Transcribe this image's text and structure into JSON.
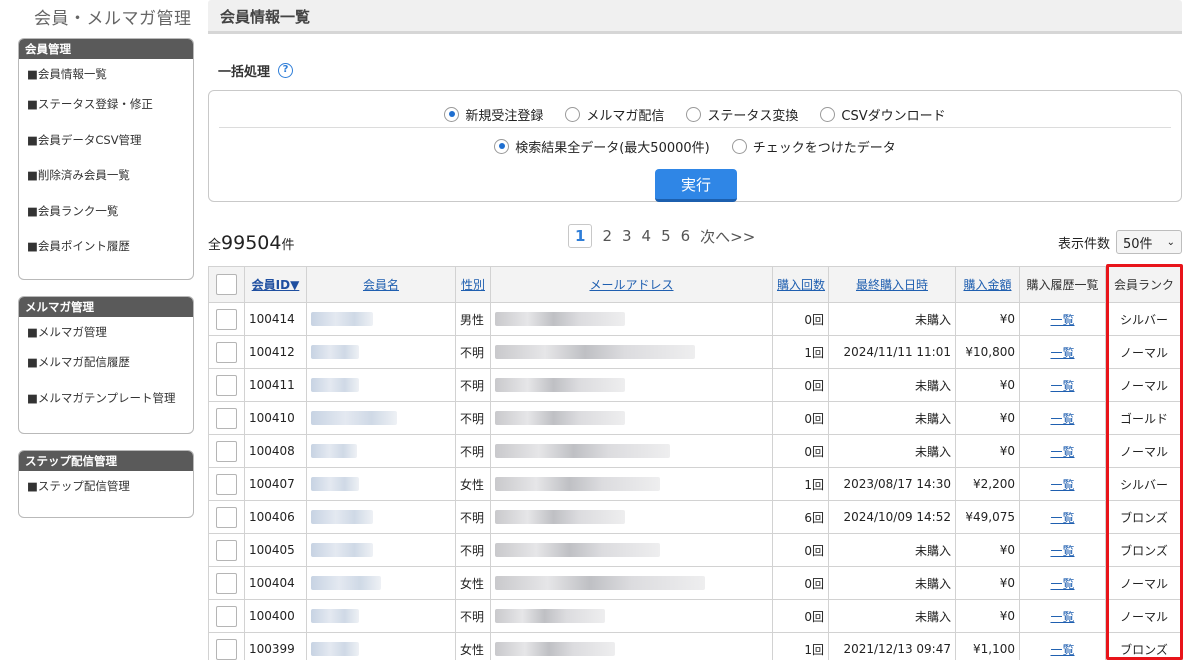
{
  "app_title": "会員・メルマガ管理",
  "sidebar": {
    "sections": [
      {
        "title": "会員管理",
        "items": [
          "■会員情報一覧",
          "■ステータス登録・修正",
          "■会員データCSV管理",
          "■削除済み会員一覧",
          "■会員ランク一覧",
          "■会員ポイント履歴"
        ]
      },
      {
        "title": "メルマガ管理",
        "items": [
          "■メルマガ管理",
          "■メルマガ配信履歴",
          "■メルマガテンプレート管理"
        ]
      },
      {
        "title": "ステップ配信管理",
        "items": [
          "■ステップ配信管理"
        ]
      }
    ]
  },
  "page_title": "会員情報一覧",
  "bulk": {
    "label": "一括処理",
    "help_icon": "question-circle-icon",
    "actions": [
      {
        "label": "新規受注登録",
        "selected": true
      },
      {
        "label": "メルマガ配信",
        "selected": false
      },
      {
        "label": "ステータス変換",
        "selected": false
      },
      {
        "label": "CSVダウンロード",
        "selected": false
      }
    ],
    "targets": [
      {
        "label": "検索結果全データ(最大50000件)",
        "selected": true
      },
      {
        "label": "チェックをつけたデータ",
        "selected": false
      }
    ],
    "execute_label": "実行"
  },
  "total": {
    "prefix": "全",
    "count": "99504",
    "suffix": "件"
  },
  "pager": {
    "current": "1",
    "pages": [
      "2",
      "3",
      "4",
      "5",
      "6"
    ],
    "next": "次へ>>"
  },
  "per_page": {
    "label": "表示件数",
    "value": "50件"
  },
  "table": {
    "headers": [
      "会員ID▼",
      "会員名",
      "性別",
      "メールアドレス",
      "購入回数",
      "最終購入日時",
      "購入金額",
      "購入履歴一覧",
      "会員ランク"
    ],
    "rows": [
      {
        "id": "100414",
        "gender": "男性",
        "count": "0回",
        "last": "未購入",
        "amount": "¥0",
        "history": "一覧",
        "rank": "シルバー"
      },
      {
        "id": "100412",
        "gender": "不明",
        "count": "1回",
        "last": "2024/11/11 11:01",
        "amount": "¥10,800",
        "history": "一覧",
        "rank": "ノーマル"
      },
      {
        "id": "100411",
        "gender": "不明",
        "count": "0回",
        "last": "未購入",
        "amount": "¥0",
        "history": "一覧",
        "rank": "ノーマル"
      },
      {
        "id": "100410",
        "gender": "不明",
        "count": "0回",
        "last": "未購入",
        "amount": "¥0",
        "history": "一覧",
        "rank": "ゴールド"
      },
      {
        "id": "100408",
        "gender": "不明",
        "count": "0回",
        "last": "未購入",
        "amount": "¥0",
        "history": "一覧",
        "rank": "ノーマル"
      },
      {
        "id": "100407",
        "gender": "女性",
        "count": "1回",
        "last": "2023/08/17 14:30",
        "amount": "¥2,200",
        "history": "一覧",
        "rank": "シルバー"
      },
      {
        "id": "100406",
        "gender": "不明",
        "count": "6回",
        "last": "2024/10/09 14:52",
        "amount": "¥49,075",
        "history": "一覧",
        "rank": "ブロンズ"
      },
      {
        "id": "100405",
        "gender": "不明",
        "count": "0回",
        "last": "未購入",
        "amount": "¥0",
        "history": "一覧",
        "rank": "ブロンズ"
      },
      {
        "id": "100404",
        "gender": "女性",
        "count": "0回",
        "last": "未購入",
        "amount": "¥0",
        "history": "一覧",
        "rank": "ノーマル"
      },
      {
        "id": "100400",
        "gender": "不明",
        "count": "0回",
        "last": "未購入",
        "amount": "¥0",
        "history": "一覧",
        "rank": "ノーマル"
      },
      {
        "id": "100399",
        "gender": "女性",
        "count": "1回",
        "last": "2021/12/13 09:47",
        "amount": "¥1,100",
        "history": "一覧",
        "rank": "ブロンズ"
      }
    ]
  },
  "colors": {
    "accent": "#2f86e6",
    "highlight_border": "#e8141a",
    "sidebar_head": "#5a5a5a"
  }
}
